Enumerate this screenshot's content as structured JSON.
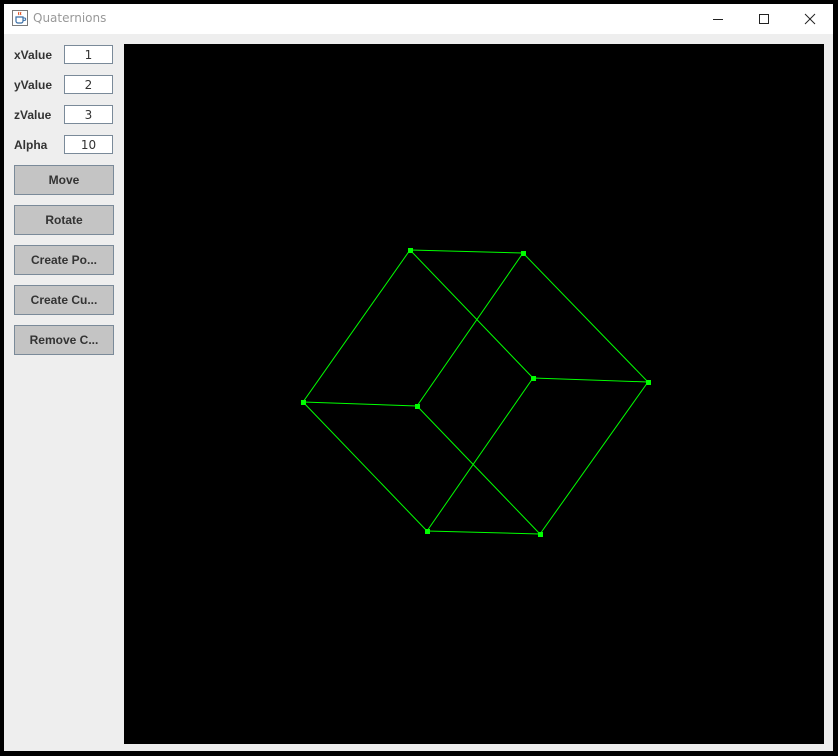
{
  "window": {
    "title": "Quaternions",
    "icon": "java-cup-icon",
    "controls": [
      "minimize-icon",
      "maximize-icon",
      "close-icon"
    ]
  },
  "fields": {
    "x": {
      "label": "xValue",
      "value": "1"
    },
    "y": {
      "label": "yValue",
      "value": "2"
    },
    "z": {
      "label": "zValue",
      "value": "3"
    },
    "alpha": {
      "label": "Alpha",
      "value": "10"
    }
  },
  "buttons": {
    "move": "Move",
    "rotate": "Rotate",
    "create_point": "Create Po...",
    "create_cube": "Create Cu...",
    "remove": "Remove C..."
  },
  "colors": {
    "canvas_bg": "#000000",
    "edge": "#00ff00",
    "vertex": "#00ff00"
  }
}
